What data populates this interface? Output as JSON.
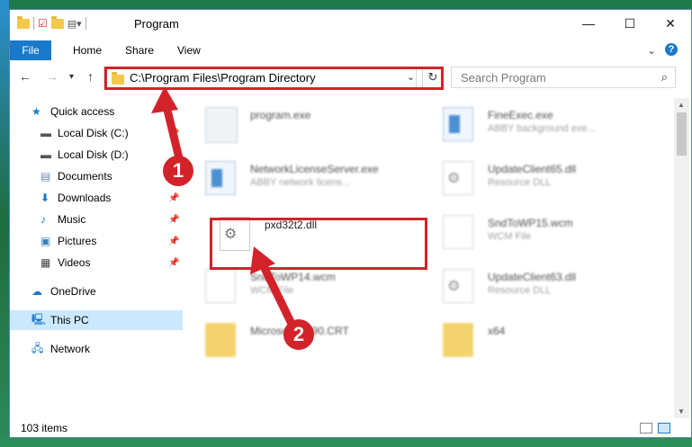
{
  "window": {
    "title": "Program"
  },
  "ribbon": {
    "file": "File",
    "tabs": [
      "Home",
      "Share",
      "View"
    ]
  },
  "address": {
    "path": "C:\\Program Files\\Program Directory"
  },
  "search": {
    "placeholder": "Search Program"
  },
  "nav": {
    "items": [
      {
        "label": "Quick access",
        "icon": "star-icon",
        "pinned": false
      },
      {
        "label": "Local Disk (C:)",
        "icon": "drive-icon",
        "pinned": true
      },
      {
        "label": "Local Disk (D:)",
        "icon": "drive-icon",
        "pinned": false
      },
      {
        "label": "Documents",
        "icon": "documents-icon",
        "pinned": true
      },
      {
        "label": "Downloads",
        "icon": "download-icon",
        "pinned": true
      },
      {
        "label": "Music",
        "icon": "music-icon",
        "pinned": true
      },
      {
        "label": "Pictures",
        "icon": "pictures-icon",
        "pinned": true
      },
      {
        "label": "Videos",
        "icon": "videos-icon",
        "pinned": true
      },
      {
        "label": "OneDrive",
        "icon": "cloud-icon",
        "pinned": false
      },
      {
        "label": "This PC",
        "icon": "computer-icon",
        "pinned": false,
        "selected": true
      },
      {
        "label": "Network",
        "icon": "network-icon",
        "pinned": false
      }
    ]
  },
  "files": [
    {
      "name": "program.exe",
      "desc": "",
      "icon": "installer-icon"
    },
    {
      "name": "FineExec.exe",
      "desc": "ABBY background exe...",
      "icon": "app-icon"
    },
    {
      "name": "NetworkLicenseServer.exe",
      "desc": "ABBY network licens...",
      "icon": "app-icon"
    },
    {
      "name": "UpdateClient65.dll",
      "desc": "Resource DLL",
      "icon": "dll-icon"
    },
    {
      "name": "pxd32t2.dll",
      "desc": "",
      "icon": "dll-icon",
      "highlighted": true
    },
    {
      "name": "SndToWP15.wcm",
      "desc": "WCM File",
      "icon": "file-icon"
    },
    {
      "name": "SndToWP14.wcm",
      "desc": "WCM File",
      "icon": "file-icon"
    },
    {
      "name": "UpdateClient63.dll",
      "desc": "Resource DLL",
      "icon": "dll-icon"
    },
    {
      "name": "Microsoft.VC90.CRT",
      "desc": "",
      "icon": "folder-icon"
    },
    {
      "name": "x64",
      "desc": "",
      "icon": "folder-icon"
    }
  ],
  "status": {
    "items_count": "103 items"
  },
  "annotations": {
    "step1": "1",
    "step2": "2",
    "color": "#d2232a"
  },
  "colors": {
    "accent": "#1979ca",
    "selection": "#cce8ff"
  }
}
